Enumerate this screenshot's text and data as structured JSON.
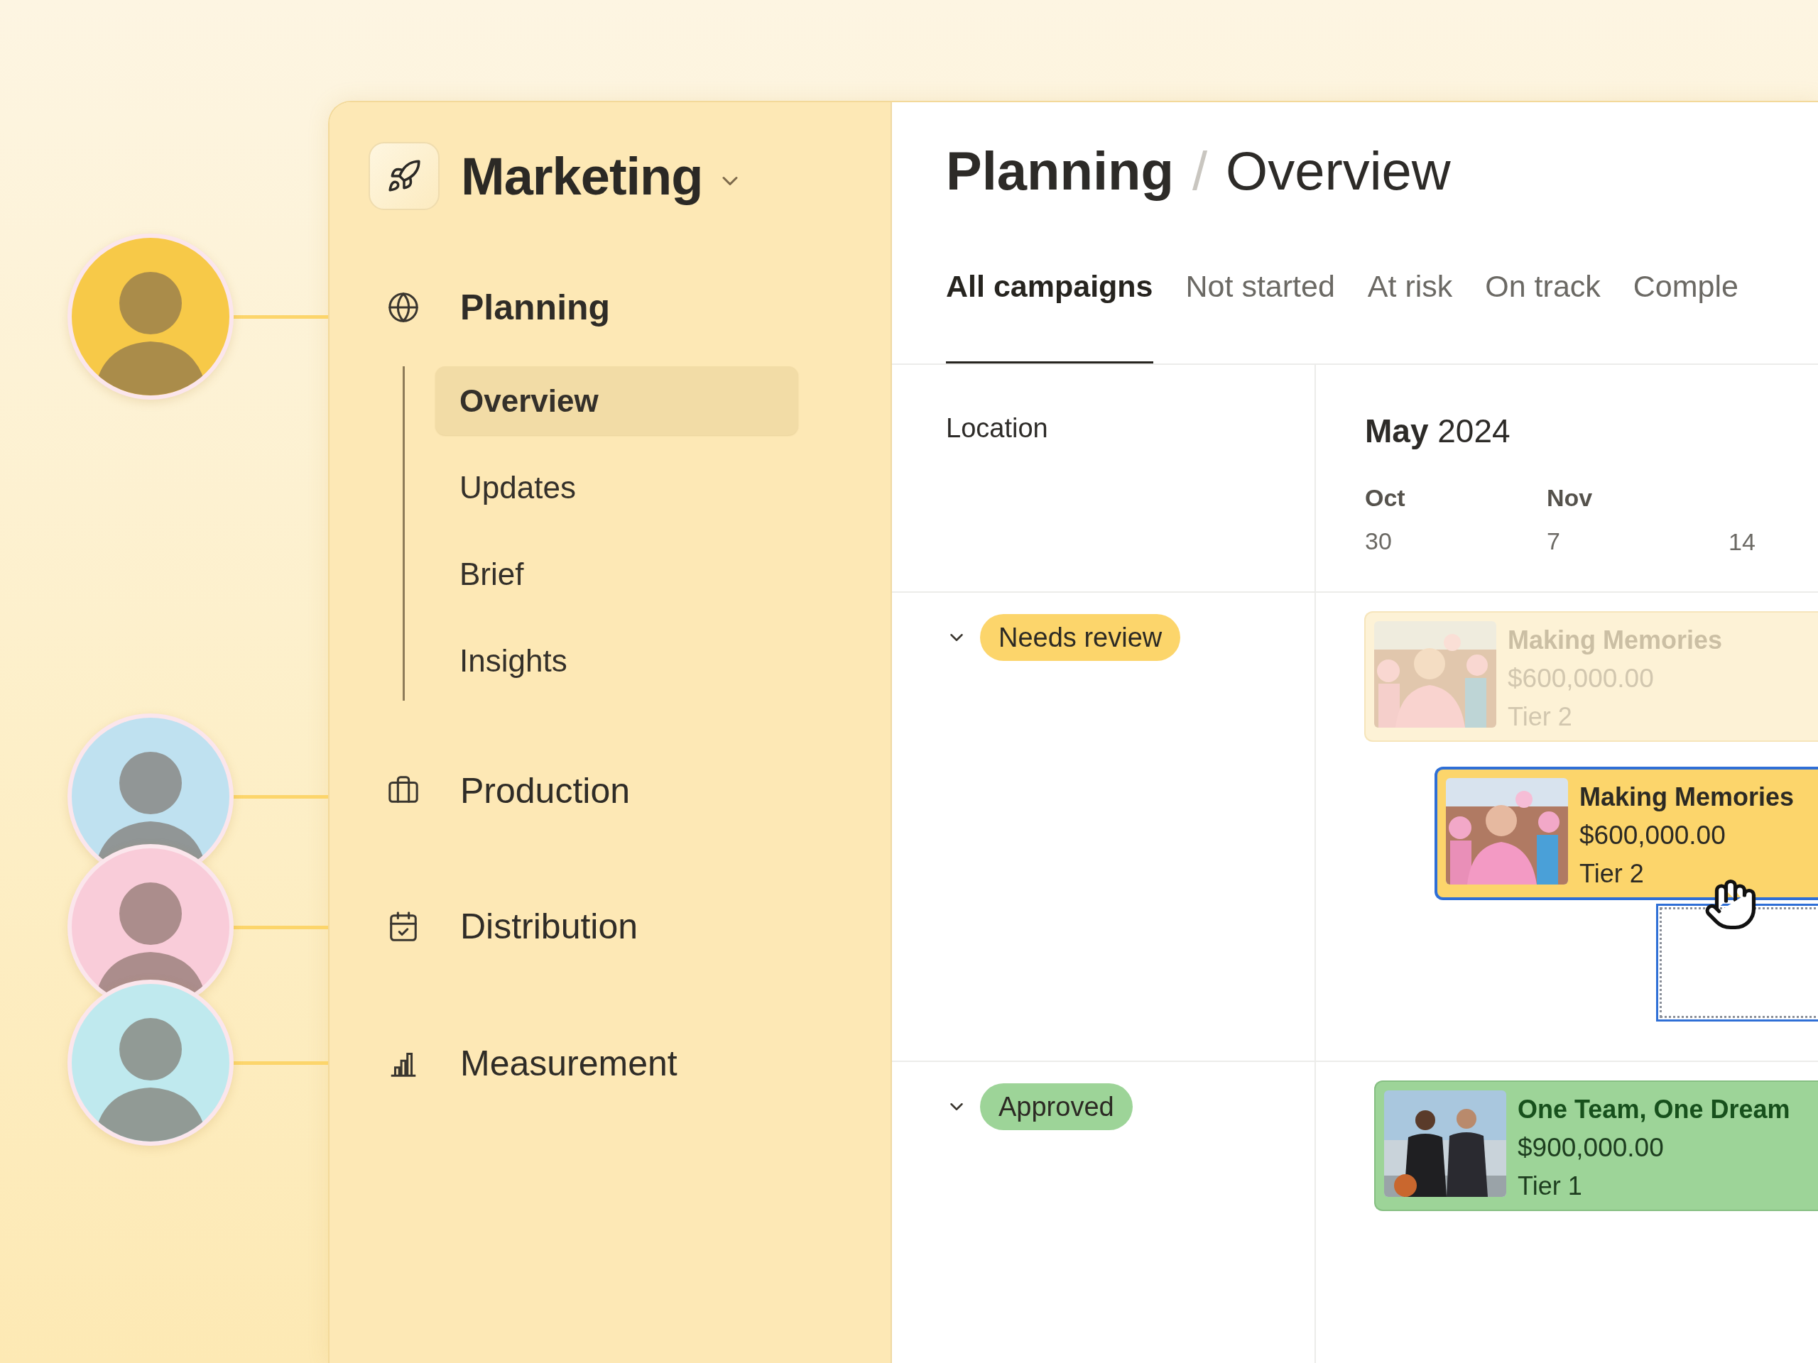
{
  "avatars": [
    {
      "color": "#f7c948"
    },
    {
      "color": "#bfe1f0"
    },
    {
      "color": "#f9ccd9"
    },
    {
      "color": "#bfe9ee"
    }
  ],
  "workspace": {
    "name": "Marketing"
  },
  "nav": [
    {
      "label": "Planning",
      "selected": true,
      "children": [
        {
          "label": "Overview",
          "selected": true
        },
        {
          "label": "Updates",
          "selected": false
        },
        {
          "label": "Brief",
          "selected": false
        },
        {
          "label": "Insights",
          "selected": false
        }
      ]
    },
    {
      "label": "Production",
      "selected": false
    },
    {
      "label": "Distribution",
      "selected": false
    },
    {
      "label": "Measurement",
      "selected": false
    }
  ],
  "breadcrumb": {
    "items": [
      "Planning",
      "Overview"
    ],
    "separator": "/"
  },
  "tabs": [
    {
      "label": "All campaigns",
      "selected": true
    },
    {
      "label": "Not started",
      "selected": false
    },
    {
      "label": "At risk",
      "selected": false
    },
    {
      "label": "On track",
      "selected": false
    },
    {
      "label": "Comple",
      "selected": false
    }
  ],
  "table": {
    "column_1": "Location",
    "period": "**May** 2024",
    "ticks": [
      {
        "month": "Oct",
        "day": "30"
      },
      {
        "month": "Nov",
        "day": "7"
      },
      {
        "day": "14"
      }
    ]
  },
  "groups": [
    {
      "label": "Needs review",
      "color": "#fcd56b",
      "expanded": true,
      "cards": [
        {
          "kind": "ghost",
          "title": "Making Memories",
          "amount": "$600,000.00",
          "tier": "Tier 2"
        },
        {
          "kind": "dragging",
          "title": "Making Memories",
          "amount": "$600,000.00",
          "tier": "Tier 2"
        }
      ]
    },
    {
      "label": "Approved",
      "color": "#9dd498",
      "expanded": true,
      "cards": [
        {
          "kind": "placed",
          "title": "One Team, One Dream",
          "amount": "$900,000.00",
          "tier": "Tier 1"
        }
      ]
    }
  ]
}
